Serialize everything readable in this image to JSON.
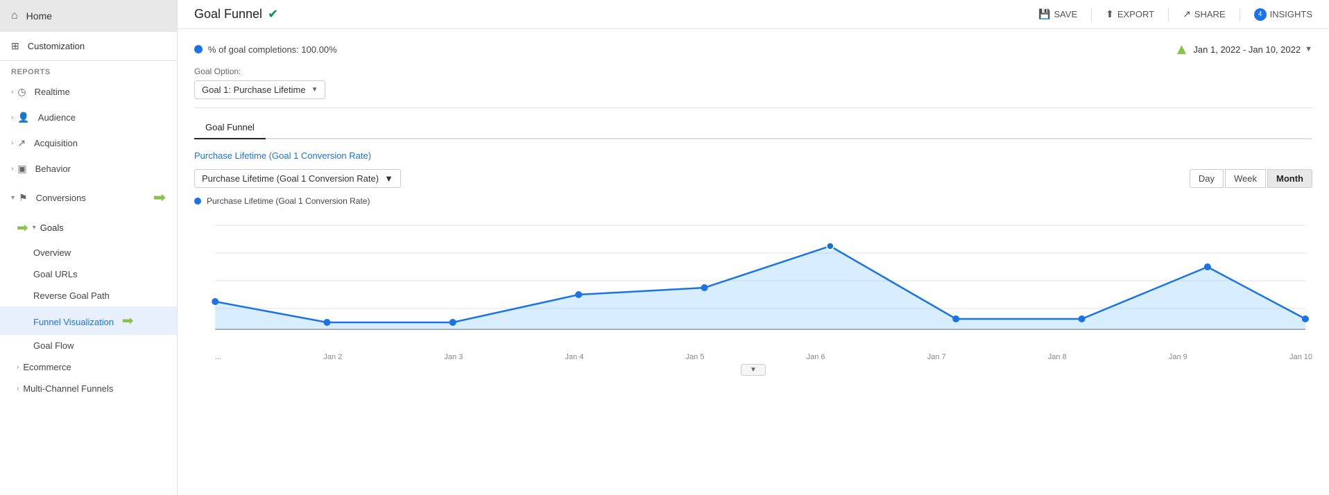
{
  "sidebar": {
    "home_label": "Home",
    "customization_label": "Customization",
    "reports_label": "REPORTS",
    "nav_items": [
      {
        "id": "realtime",
        "label": "Realtime"
      },
      {
        "id": "audience",
        "label": "Audience"
      },
      {
        "id": "acquisition",
        "label": "Acquisition"
      },
      {
        "id": "behavior",
        "label": "Behavior"
      },
      {
        "id": "conversions",
        "label": "Conversions"
      }
    ],
    "goals_label": "Goals",
    "goals_sub_items": [
      {
        "id": "overview",
        "label": "Overview"
      },
      {
        "id": "goal-urls",
        "label": "Goal URLs"
      },
      {
        "id": "reverse-goal-path",
        "label": "Reverse Goal Path"
      },
      {
        "id": "funnel-visualization",
        "label": "Funnel Visualization",
        "active": true
      },
      {
        "id": "goal-flow",
        "label": "Goal Flow"
      }
    ],
    "ecommerce_label": "Ecommerce",
    "multichannel_label": "Multi-Channel Funnels"
  },
  "header": {
    "title": "Goal Funnel",
    "save_label": "SAVE",
    "export_label": "EXPORT",
    "share_label": "SHARE",
    "insights_label": "INSIGHTS",
    "insights_count": "4"
  },
  "content": {
    "completions_text": "% of goal completions: 100.00%",
    "date_range": "Jan 1, 2022 - Jan 10, 2022",
    "goal_option_label": "Goal Option:",
    "goal_select_value": "Goal 1: Purchase Lifetime",
    "tab_label": "Goal Funnel",
    "conversion_rate_label": "Purchase Lifetime (Goal 1 Conversion Rate)",
    "metric_select_value": "Purchase Lifetime (Goal 1 Conversion Rate)",
    "time_buttons": [
      "Day",
      "Week",
      "Month"
    ],
    "active_time_button": "Month",
    "chart_legend_label": "Purchase Lifetime (Goal 1 Conversion Rate)",
    "x_axis_labels": [
      "...",
      "Jan 2",
      "Jan 3",
      "Jan 4",
      "Jan 5",
      "Jan 6",
      "Jan 7",
      "Jan 8",
      "Jan 9",
      "Jan 10"
    ]
  },
  "icons": {
    "home": "⌂",
    "customization": "⊞",
    "realtime": "◷",
    "audience": "👤",
    "acquisition": "↗",
    "behavior": "▣",
    "conversions": "⚑",
    "check": "✔",
    "save": "💾",
    "export": "⬆",
    "share": "↗",
    "insights": "👤",
    "chevron_down": "▼",
    "chevron_right": "›",
    "up_arrow": "↑"
  }
}
